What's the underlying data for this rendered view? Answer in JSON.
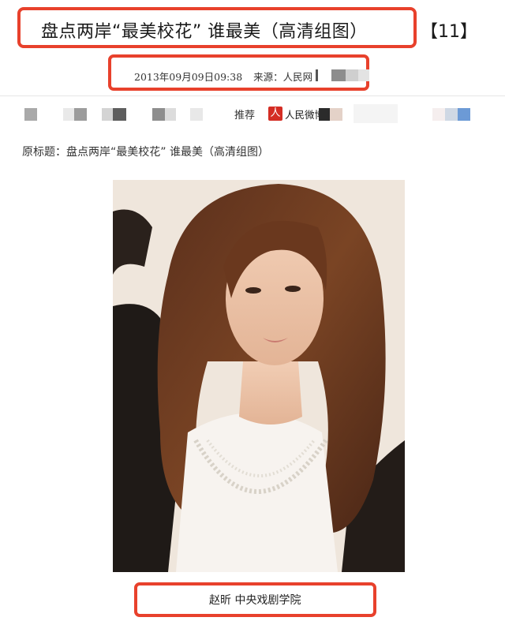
{
  "article": {
    "title": "盘点两岸“最美校花” 谁最美（高清组图）",
    "page_indicator": "【11】",
    "datetime": "2013年09月09日09:38",
    "source_label": "来源：",
    "source_name": "人民网",
    "original_title": "原标题：盘点两岸“最美校花” 谁最美（高清组图）"
  },
  "share_bar": {
    "recommend_label": "推荐",
    "weibo_icon_glyph": "人",
    "weibo_label": "人民微博"
  },
  "photo": {
    "caption": "赵昕 中央戏剧学院"
  },
  "colors": {
    "highlight_border": "#e8412c",
    "weibo_red": "#d42d24"
  }
}
